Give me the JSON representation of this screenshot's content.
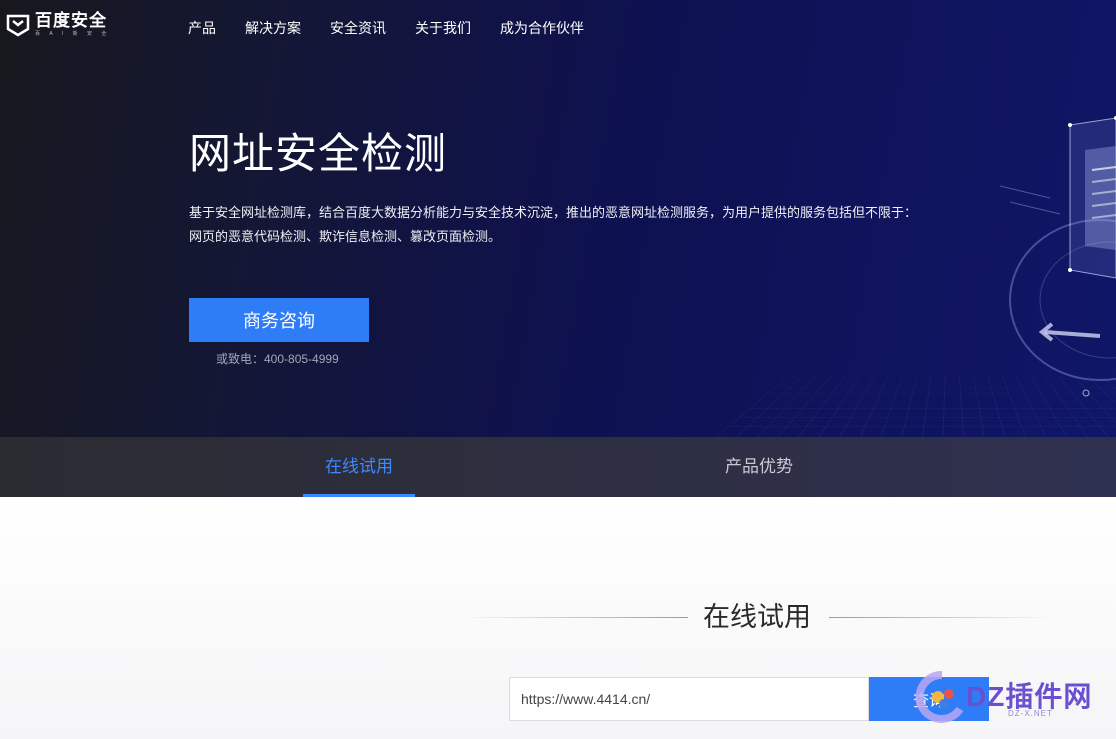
{
  "brand": {
    "name": "百度安全",
    "tagline": "百 A I 新 安 全"
  },
  "nav": {
    "items": [
      "产品",
      "解决方案",
      "安全资讯",
      "关于我们",
      "成为合作伙伴"
    ]
  },
  "hero": {
    "title": "网址安全检测",
    "description": "基于安全网址检测库，结合百度大数据分析能力与安全技术沉淀，推出的恶意网址检测服务，为用户提供的服务包括但不限于：网页的恶意代码检测、欺诈信息检测、篡改页面检测。",
    "cta_label": "商务咨询",
    "hotline": "或致电：400-805-4999"
  },
  "tabs": [
    {
      "label": "在线试用",
      "active": true
    },
    {
      "label": "产品优势",
      "active": false
    }
  ],
  "trial": {
    "section_title": "在线试用",
    "url_value": "https://www.4414.cn/",
    "query_label": "查询"
  },
  "watermark": {
    "text": "DZ插件网",
    "sub": "DZ-X.NET"
  },
  "colors": {
    "accent": "#2f7df6",
    "tab_active": "#3d88ff",
    "hero_bg": "#0e1150"
  }
}
